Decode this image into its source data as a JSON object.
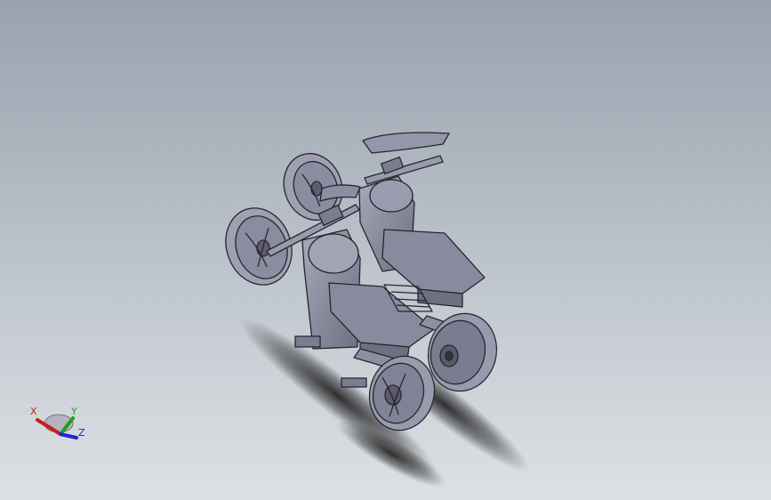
{
  "triad": {
    "x_label": "X",
    "y_label": "Y",
    "z_label": "Z",
    "x_color": "#c81e1e",
    "y_color": "#1ea01e",
    "z_color": "#1e28d2"
  },
  "model": {
    "body_color": "#8f8fa3",
    "edge_color": "#26262e",
    "shadow_color": "#1a1a1a"
  }
}
